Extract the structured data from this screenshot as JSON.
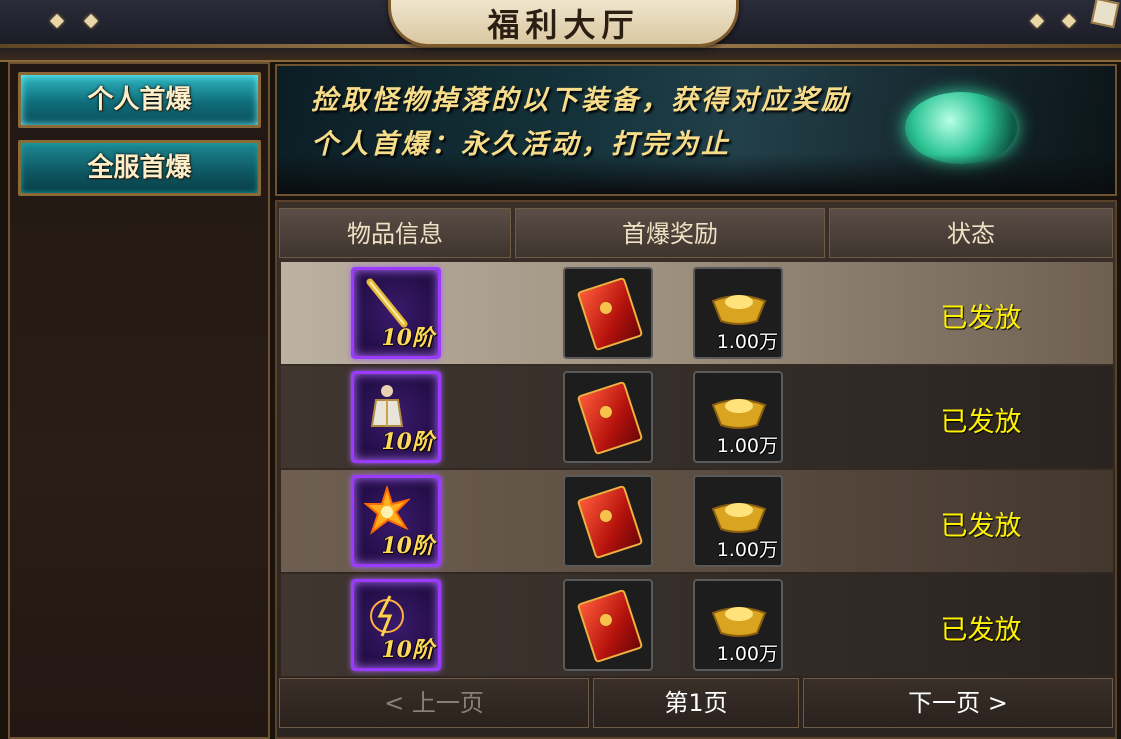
{
  "window": {
    "title": "福利大厅"
  },
  "sidebar": {
    "items": [
      {
        "label": "个人首爆",
        "active": true
      },
      {
        "label": "全服首爆",
        "active": false
      }
    ]
  },
  "banner": {
    "line1": "捡取怪物掉落的以下装备，获得对应奖励",
    "line2": "个人首爆：永久活动，打完为止"
  },
  "table": {
    "headers": [
      "物品信息",
      "首爆奖励",
      "状态"
    ],
    "rows": [
      {
        "item_tier": "10阶",
        "item_icon": "golden-staff-icon",
        "reward_gold": "1.00万",
        "status": "已发放"
      },
      {
        "item_tier": "10阶",
        "item_icon": "armor-figure-icon",
        "reward_gold": "1.00万",
        "status": "已发放"
      },
      {
        "item_tier": "10阶",
        "item_icon": "fire-burst-icon",
        "reward_gold": "1.00万",
        "status": "已发放"
      },
      {
        "item_tier": "10阶",
        "item_icon": "lightning-orb-icon",
        "reward_gold": "1.00万",
        "status": "已发放"
      }
    ]
  },
  "pagination": {
    "prev": "< 上一页",
    "current": "第1页",
    "next": "下一页 >"
  },
  "colors": {
    "accent_teal": "#0f6d7a",
    "status_yellow": "#fff200",
    "item_frame_purple": "#9a3bff"
  }
}
